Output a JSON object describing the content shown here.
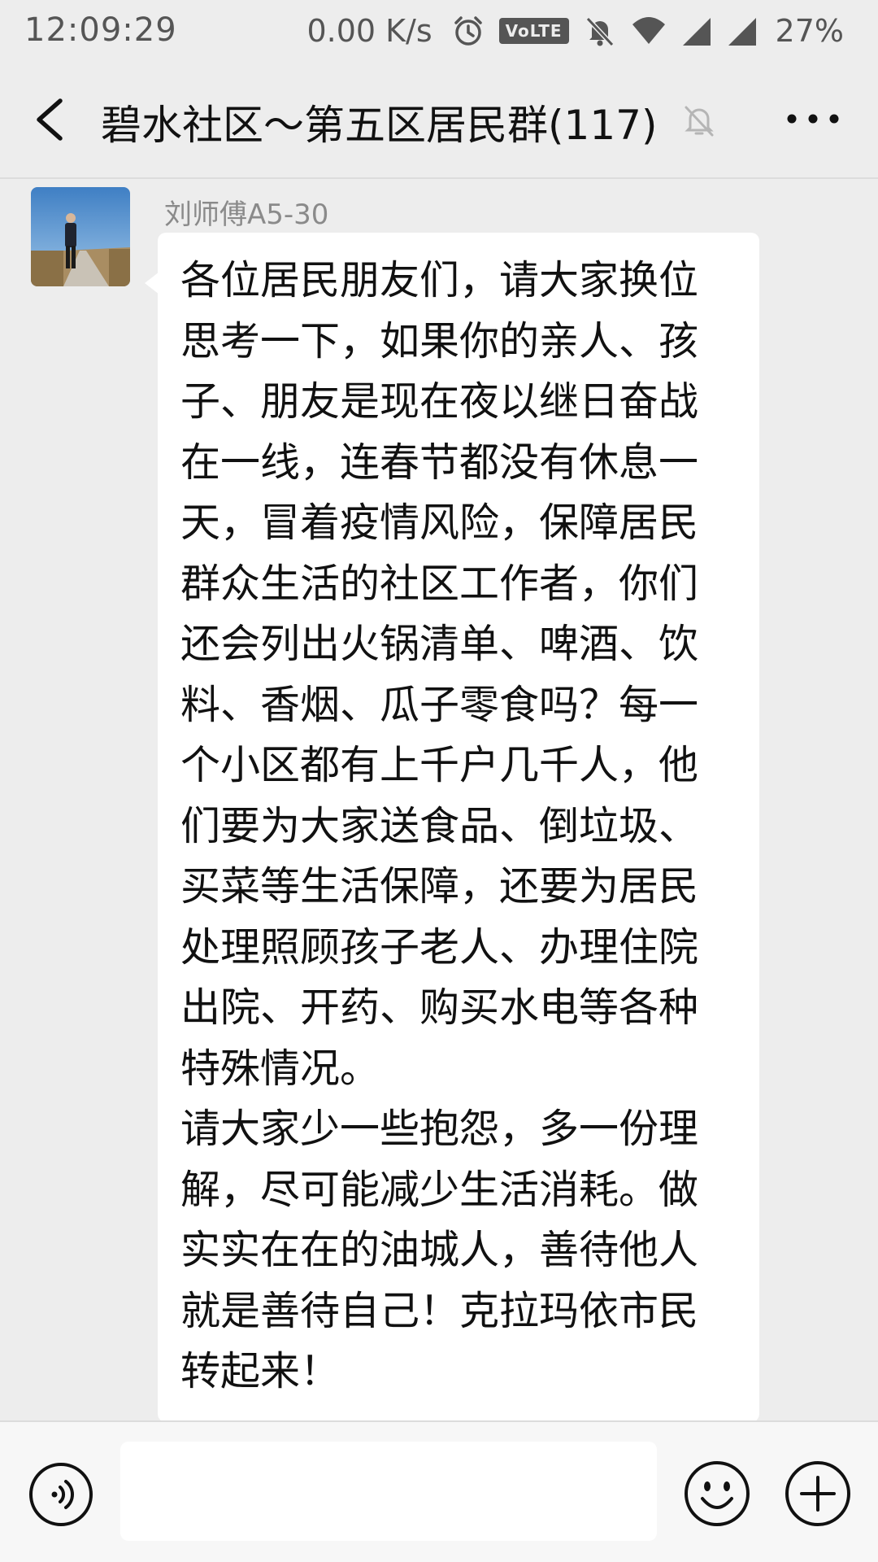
{
  "status_bar": {
    "time": "12:09:29",
    "network_speed": "0.00 K/s",
    "volte_label": "VoLTE",
    "battery": "27%",
    "icons": [
      "alarm-icon",
      "volte-icon",
      "notifications-off-icon",
      "wifi-icon",
      "signal-icon",
      "signal-icon"
    ]
  },
  "header": {
    "title": "碧水社区～第五区居民群(117)",
    "icons": [
      "back-arrow-icon",
      "mute-bell-icon",
      "more-dots-icon"
    ]
  },
  "message": {
    "sender": "刘师傅A5-30",
    "avatar": "avatar-photo",
    "text": "各位居民朋友们，请大家换位\n思考一下，如果你的亲人、孩\n子、朋友是现在夜以继日奋战\n在一线，连春节都没有休息一\n天，冒着疫情风险，保障居民\n群众生活的社区工作者，你们\n还会列出火锅清单、啤酒、饮\n料、香烟、瓜子零食吗？每一\n个小区都有上千户几千人，他\n们要为大家送食品、倒垃圾、\n买菜等生活保障，还要为居民\n处理照顾孩子老人、办理住院\n出院、开药、购买水电等各种\n特殊情况。\n请大家少一些抱怨，多一份理\n解，尽可能减少生活消耗。做\n实实在在的油城人，善待他人\n就是善待自己！克拉玛依市民\n转起来！"
  },
  "input_bar": {
    "input_value": "",
    "icons": [
      "voice-icon",
      "emoji-icon",
      "plus-icon"
    ]
  },
  "colors": {
    "background": "#ededed",
    "bubble": "#ffffff",
    "sender_name": "#8a8a8a",
    "input_bar": "#f7f7f7"
  }
}
